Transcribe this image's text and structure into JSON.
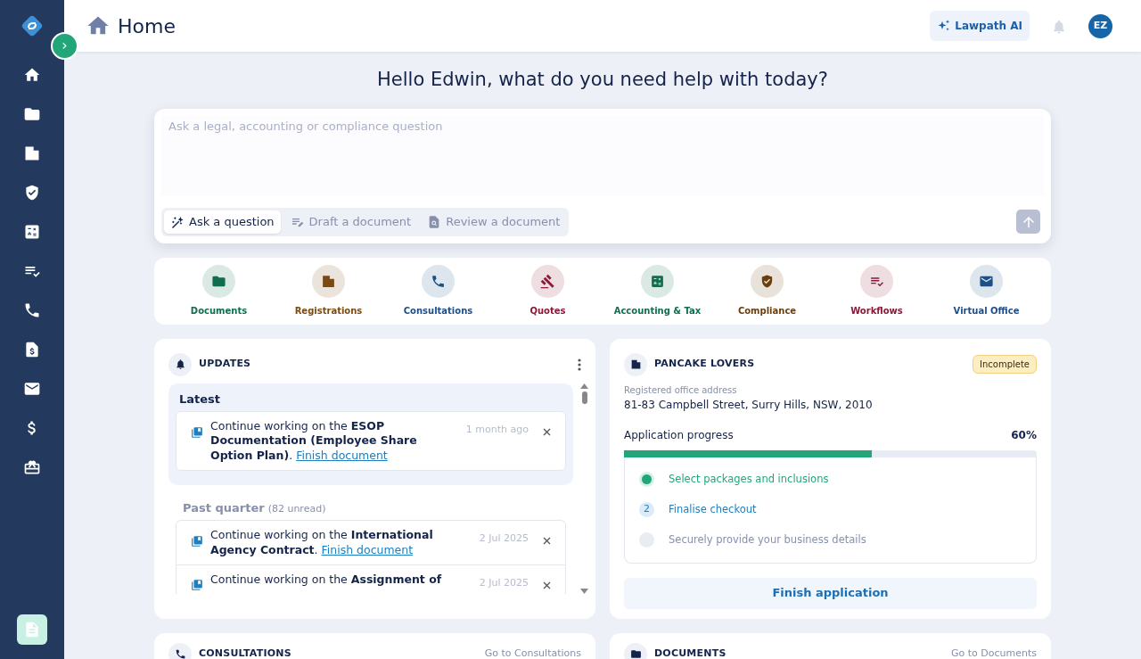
{
  "sidebar": {
    "expand_button": "›",
    "items": [
      {
        "selected": false
      },
      {
        "selected": false
      },
      {
        "selected": false
      },
      {
        "selected": false
      },
      {
        "selected": false
      },
      {
        "selected": false
      },
      {
        "selected": false
      },
      {
        "selected": false
      },
      {
        "selected": false
      },
      {
        "selected": false
      },
      {
        "selected": false
      }
    ]
  },
  "header": {
    "title": "Home",
    "ai_button": "Lawpath AI",
    "avatar": "EZ"
  },
  "greeting": "Hello Edwin, what do you need help with today?",
  "ask": {
    "placeholder": "Ask a legal, accounting or compliance question",
    "modes": [
      {
        "label": "Ask a question",
        "selected": true
      },
      {
        "label": "Draft a document",
        "selected": false
      },
      {
        "label": "Review a document",
        "selected": false
      }
    ]
  },
  "quick_links": [
    {
      "label": "Documents",
      "color": "#0f6e4e"
    },
    {
      "label": "Registrations",
      "color": "#7a4a12"
    },
    {
      "label": "Consultations",
      "color": "#1d4f86"
    },
    {
      "label": "Quotes",
      "color": "#8a1838"
    },
    {
      "label": "Accounting & Tax",
      "color": "#0f6e4e"
    },
    {
      "label": "Compliance",
      "color": "#6b3d0c"
    },
    {
      "label": "Workflows",
      "color": "#8a1838"
    },
    {
      "label": "Virtual Office",
      "color": "#1d4f86"
    }
  ],
  "updates": {
    "title": "UPDATES",
    "latest_heading": "Latest",
    "latest": [
      {
        "text": "Continue working on the **ESOP Documentation (Employee Share Option Plan)**.",
        "link": "Finish document",
        "time": "1 month ago"
      }
    ],
    "past_heading": "Past quarter",
    "past_count": "(82 unread)",
    "past": [
      {
        "text": "Continue working on the **International Agency Contract**.",
        "link": "Finish document",
        "time": "2 Jul 2025"
      },
      {
        "text": "Continue working on the **Assignment of**",
        "time": "2 Jul 2025"
      }
    ]
  },
  "company": {
    "name": "PANCAKE LOVERS",
    "status": "Incomplete",
    "address_label": "Registered office address",
    "address": "81-83 Campbell Street, Surry Hills, NSW, 2010",
    "progress_label": "Application progress",
    "progress_value": "60%",
    "level": 0.6,
    "steps": [
      {
        "kind": "done",
        "label": "Select packages and inclusions"
      },
      {
        "kind": "current",
        "number": "2",
        "label": "Finalise checkout"
      },
      {
        "kind": "pending",
        "label": "Securely provide your business details"
      }
    ],
    "button": "Finish application"
  },
  "bottom_cards": [
    {
      "title": "CONSULTATIONS",
      "link": "Go to Consultations"
    },
    {
      "title": "DOCUMENTS",
      "link": "Go to Documents"
    }
  ]
}
